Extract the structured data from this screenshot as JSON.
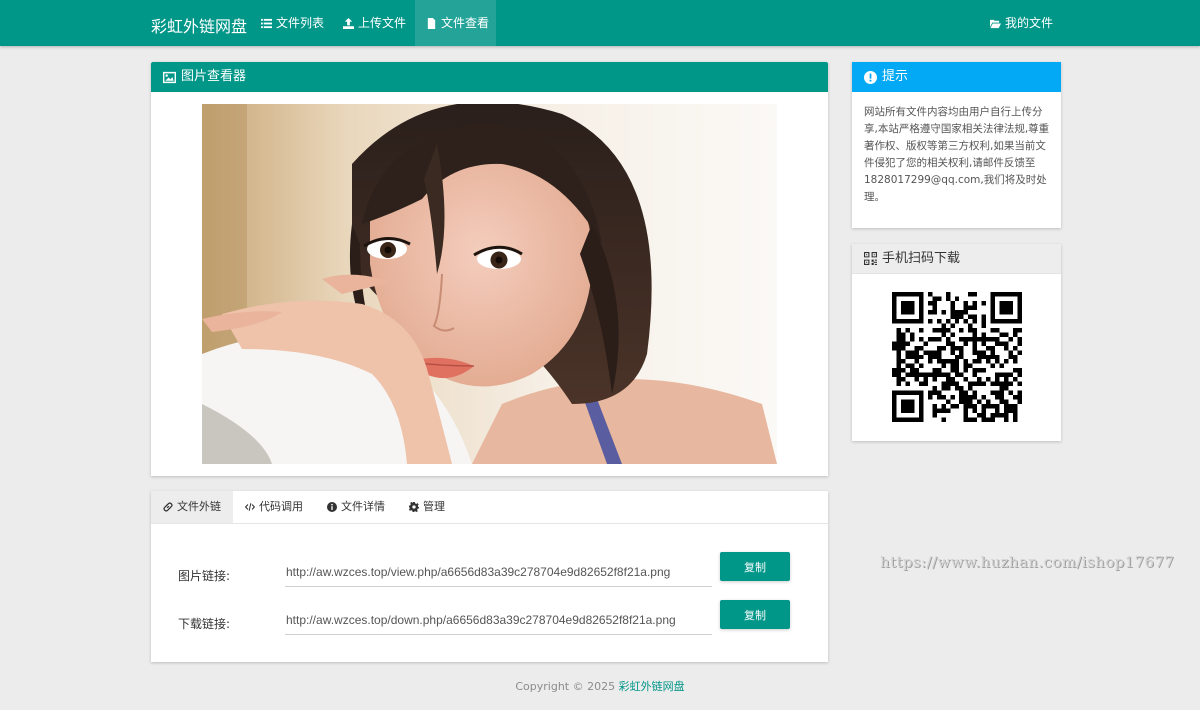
{
  "app": {
    "brand": "彩虹外链网盘",
    "accent_color": "#009688",
    "info_color": "#03a9f4"
  },
  "nav": {
    "items": [
      {
        "label": "文件列表",
        "icon": "list-icon"
      },
      {
        "label": "上传文件",
        "icon": "upload-icon"
      },
      {
        "label": "文件查看",
        "icon": "file-icon",
        "active": true
      }
    ],
    "right": {
      "label": "我的文件",
      "icon": "folder-open-icon"
    }
  },
  "viewer": {
    "title": "图片查看器",
    "icon": "image-icon"
  },
  "links_panel": {
    "tabs": [
      {
        "label": "文件外链",
        "icon": "link-icon",
        "active": true
      },
      {
        "label": "代码调用",
        "icon": "code-icon"
      },
      {
        "label": "文件详情",
        "icon": "info-circle-icon"
      },
      {
        "label": "管理",
        "icon": "gear-icon"
      }
    ],
    "image_link": {
      "label": "图片链接:",
      "value": "http://aw.wzces.top/view.php/a6656d83a39c278704e9d82652f8f21a.png",
      "button": "复制"
    },
    "download_link": {
      "label": "下载链接:",
      "value": "http://aw.wzces.top/down.php/a6656d83a39c278704e9d82652f8f21a.png",
      "button": "复制"
    }
  },
  "tip": {
    "title": "提示",
    "icon": "exclamation-circle-icon",
    "body": "网站所有文件内容均由用户自行上传分享,本站严格遵守国家相关法律法规,尊重著作权、版权等第三方权利,如果当前文件侵犯了您的相关权利,请邮件反馈至1828017299@qq.com,我们将及时处理。"
  },
  "qr": {
    "title": "手机扫码下载",
    "icon": "qrcode-icon"
  },
  "watermark": "https://www.huzhan.com/ishop17677",
  "footer": {
    "copyright": "Copyright © 2025 ",
    "brand": "彩虹外链网盘"
  }
}
